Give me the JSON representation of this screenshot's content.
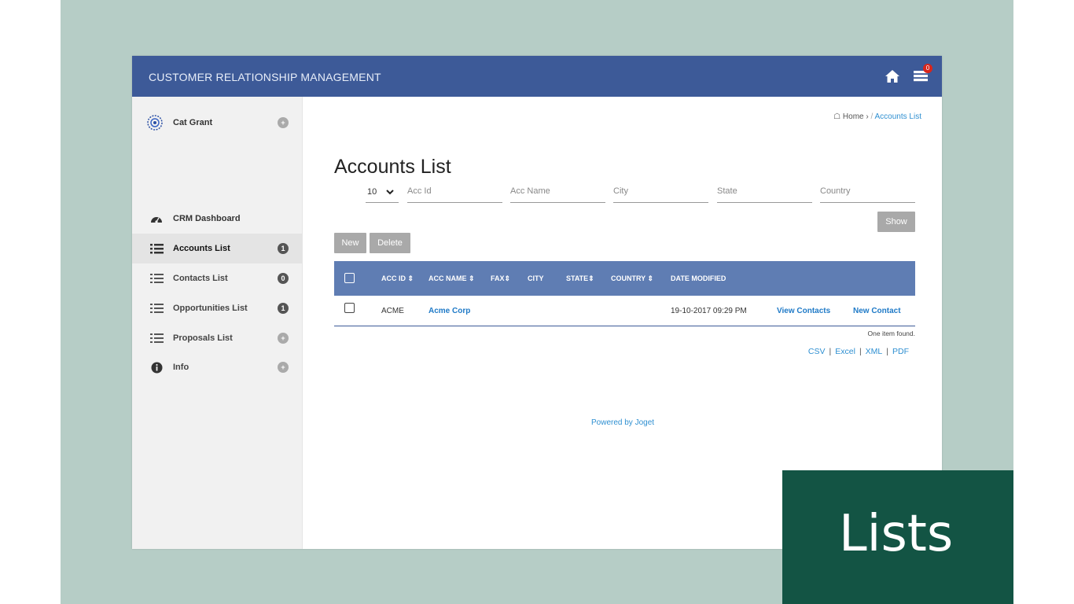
{
  "app": {
    "title": "CUSTOMER RELATIONSHIP MANAGEMENT",
    "notification_count": "0"
  },
  "sidebar": {
    "user": {
      "name": "Cat Grant"
    },
    "items": [
      {
        "label": "CRM Dashboard",
        "icon": "dashboard-icon",
        "badge": ""
      },
      {
        "label": "Accounts List",
        "icon": "list-icon",
        "badge": "1",
        "active": true
      },
      {
        "label": "Contacts List",
        "icon": "list-icon",
        "badge": "0"
      },
      {
        "label": "Opportunities List",
        "icon": "list-icon",
        "badge": "1"
      },
      {
        "label": "Proposals List",
        "icon": "list-icon",
        "badge": ""
      },
      {
        "label": "Info",
        "icon": "info-icon",
        "badge": ""
      }
    ]
  },
  "breadcrumb": {
    "home": "Home",
    "separator": "/",
    "current": "Accounts List"
  },
  "page": {
    "title": "Accounts List"
  },
  "filters": {
    "page_size": "10",
    "acc_id_placeholder": "Acc Id",
    "acc_name_placeholder": "Acc Name",
    "city_placeholder": "City",
    "state_placeholder": "State",
    "country_placeholder": "Country",
    "show_label": "Show"
  },
  "actions": {
    "new_label": "New",
    "delete_label": "Delete"
  },
  "table": {
    "columns": [
      "ACC ID",
      "ACC NAME",
      "FAX",
      "CITY",
      "STATE",
      "COUNTRY",
      "DATE MODIFIED"
    ],
    "rows": [
      {
        "acc_id": "ACME",
        "acc_name": "Acme Corp",
        "fax": "",
        "city": "",
        "state": "",
        "country": "",
        "date_modified": "19-10-2017 09:29 PM",
        "view_contacts": "View Contacts",
        "new_contact": "New Contact"
      }
    ],
    "found_text": "One item found."
  },
  "exports": [
    "CSV",
    "Excel",
    "XML",
    "PDF"
  ],
  "footer": {
    "powered_by": "Powered by Joget"
  },
  "slide": {
    "caption": "Lists"
  },
  "colors": {
    "topbar": "#3d5a98",
    "table_header": "#5f7db3",
    "link": "#1f7ac7",
    "slide_background": "#b6cdc6",
    "caption_box": "#135444"
  }
}
